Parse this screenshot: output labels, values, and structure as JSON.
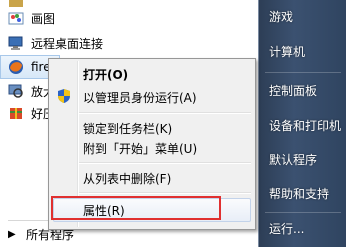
{
  "programs": [
    {
      "label": "画图",
      "icon": "paint-icon"
    },
    {
      "label": "远程桌面连接",
      "icon": "remote-desktop-icon"
    },
    {
      "label": "fire",
      "icon": "firefox-icon"
    },
    {
      "label": "放大",
      "icon": "magnifier-icon"
    },
    {
      "label": "好压",
      "icon": "haozip-icon"
    }
  ],
  "all_programs_label": "所有程序",
  "right_pane": {
    "items": [
      "游戏",
      "计算机",
      "控制面板",
      "设备和打印机",
      "默认程序",
      "帮助和支持",
      "运行..."
    ]
  },
  "context_menu": {
    "items": [
      {
        "label": "打开(O)",
        "bold": true
      },
      {
        "label": "以管理员身份运行(A)",
        "icon": "uac-shield-icon"
      },
      {
        "label": "锁定到任务栏(K)"
      },
      {
        "label": "附到「开始」菜单(U)"
      },
      {
        "label": "从列表中删除(F)"
      },
      {
        "label": "属性(R)",
        "highlighted": true
      }
    ]
  },
  "colors": {
    "highlight_box": "#e03030",
    "right_pane": "#34486a"
  }
}
